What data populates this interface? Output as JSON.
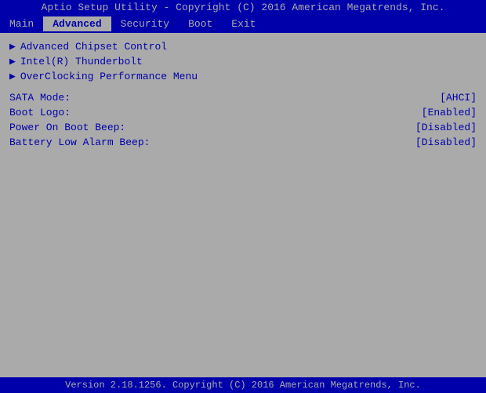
{
  "title_bar": {
    "text": "Aptio Setup Utility - Copyright (C) 2016 American Megatrends, Inc."
  },
  "menu": {
    "items": [
      {
        "label": "Main",
        "active": false
      },
      {
        "label": "Advanced",
        "active": true
      },
      {
        "label": "Security",
        "active": false
      },
      {
        "label": "Boot",
        "active": false
      },
      {
        "label": "Exit",
        "active": false
      }
    ]
  },
  "submenu_items": [
    {
      "label": "Advanced Chipset Control"
    },
    {
      "label": "Intel(R) Thunderbolt"
    },
    {
      "label": "OverClocking Performance Menu"
    }
  ],
  "settings": [
    {
      "label": "SATA Mode:",
      "value": "[AHCI]"
    },
    {
      "label": "Boot Logo:",
      "value": "[Enabled]"
    },
    {
      "label": "Power On Boot Beep:",
      "value": "[Disabled]"
    },
    {
      "label": "Battery Low Alarm Beep:",
      "value": "[Disabled]"
    }
  ],
  "footer": {
    "text": "Version 2.18.1256. Copyright (C) 2016 American Megatrends, Inc."
  }
}
